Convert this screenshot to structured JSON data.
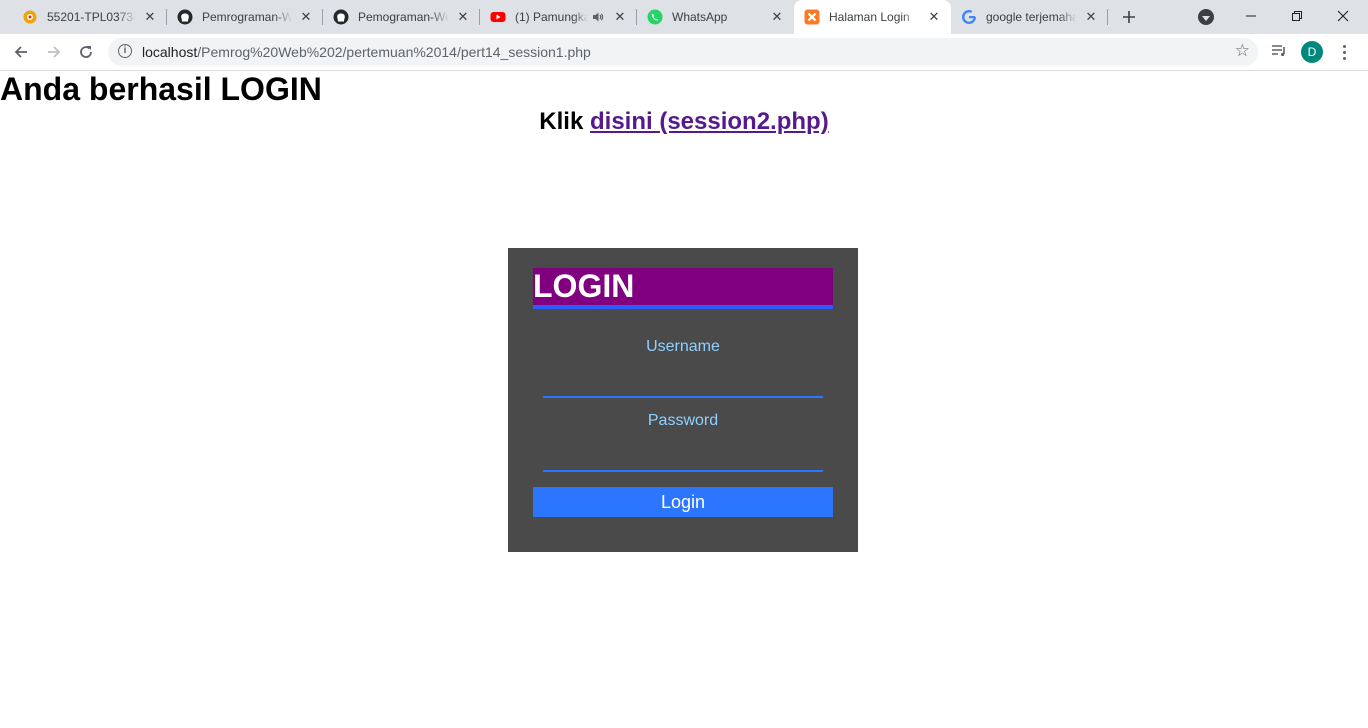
{
  "browser": {
    "tabs": [
      {
        "title": "55201-TPL0373-0",
        "icon": "moodle-icon",
        "active": false
      },
      {
        "title": "Pemrograman-W",
        "icon": "github-icon",
        "active": false
      },
      {
        "title": "Pemograman-We",
        "icon": "github-icon",
        "active": false
      },
      {
        "title": "(1) Pamungka",
        "icon": "youtube-icon",
        "active": false,
        "audio": true
      },
      {
        "title": "WhatsApp",
        "icon": "whatsapp-icon",
        "active": false
      },
      {
        "title": "Halaman Login",
        "icon": "xampp-icon",
        "active": true
      },
      {
        "title": "google terjemaha",
        "icon": "google-icon",
        "active": false
      }
    ],
    "url_host": "localhost",
    "url_path": "/Pemrog%20Web%202/pertemuan%2014/pert14_session1.php",
    "profile_initial": "D",
    "colors": {
      "profile": "#00897b",
      "tabstrip": "#dee1e6"
    }
  },
  "page": {
    "heading": "Anda berhasil LOGIN",
    "klik_prefix": "Klik ",
    "link_text": "disini (session2.php)",
    "login": {
      "title": "LOGIN",
      "username_label": "Username",
      "password_label": "Password",
      "username_value": "",
      "password_value": "",
      "button_label": "Login"
    },
    "colors": {
      "box_bg": "#4a4a4a",
      "title_bg": "#800080",
      "accent": "#2c76ff",
      "label": "#8fd0ff",
      "link": "#551a8b"
    }
  }
}
